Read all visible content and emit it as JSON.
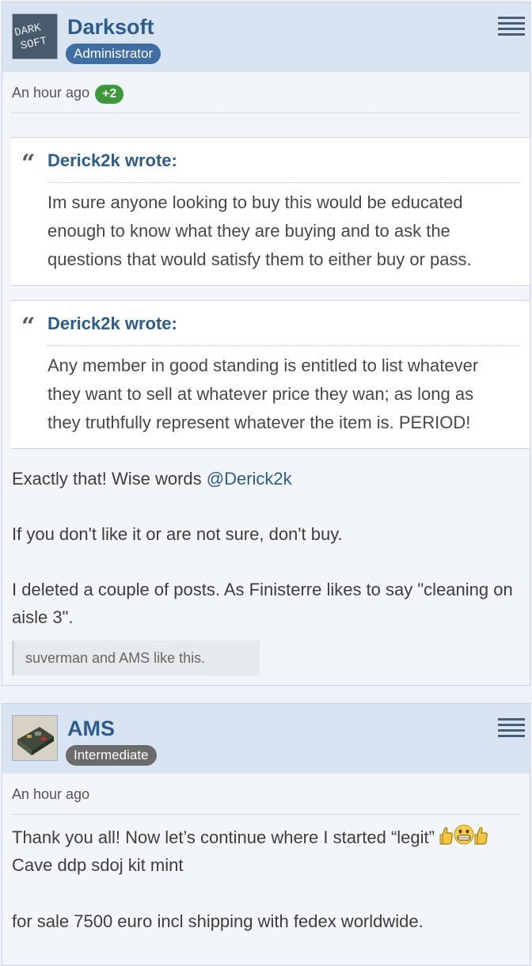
{
  "posts": [
    {
      "username": "Darksoft",
      "role": "Administrator",
      "time": "An hour ago",
      "reactions": "+2",
      "quotes": [
        {
          "author": "Derick2k wrote:",
          "text": "Im sure anyone looking to buy this would be educated enough to know what they are buying and to ask the questions that would satisfy them to either buy or pass."
        },
        {
          "author": "Derick2k wrote:",
          "text": "Any member in good standing is entitled to list whatever they want to sell at whatever price they wan; as long as they truthfully represent whatever the item is. PERIOD!"
        }
      ],
      "body": {
        "line1": "Exactly that! Wise words ",
        "mention": "@Derick2k",
        "line2": "If you don't like it or are not sure, don't buy.",
        "line3": "I deleted a couple of posts. As Finisterre likes to say \"cleaning on aisle 3\"."
      },
      "likes": "suverman and AMS like this."
    },
    {
      "username": "AMS",
      "role": "Intermediate",
      "time": "An hour ago",
      "body": {
        "line1": "Thank you all! Now let’s continue where I started “legit”",
        "line2": "Cave ddp sdoj kit mint",
        "line3": "for sale 7500 euro incl shipping with fedex worldwide."
      }
    }
  ],
  "icons": {
    "menu": "hamburger-menu-icon",
    "quote": "quote-icon",
    "emoji": "thumbs-up-grin-emoji"
  },
  "avatar_text": "DARK SOFT",
  "colors": {
    "link": "#2d5c8f",
    "header_bg": "#d9e4f3",
    "admin_badge": "#3e6ea3",
    "intermediate_badge": "#6b6b6b",
    "reaction_badge": "#3c9a38"
  }
}
